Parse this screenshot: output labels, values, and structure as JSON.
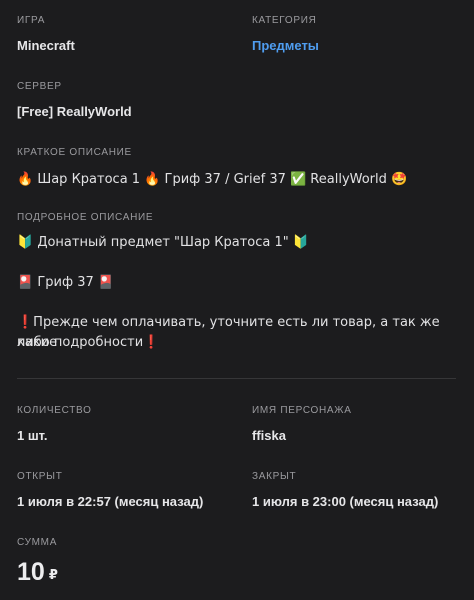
{
  "game": {
    "label": "Игра",
    "value": "Minecraft"
  },
  "category": {
    "label": "Категория",
    "value": "Предметы"
  },
  "server": {
    "label": "Сервер",
    "value": "[Free] ReallyWorld"
  },
  "short_description": {
    "label": "Краткое описание",
    "value": "🔥 Шар Кратоса 1 🔥 Гриф 37 / Grief 37 ✅ ReallyWorld 🤩"
  },
  "full_description": {
    "label": "Подробное описание",
    "line1": "🔰 Донатный предмет \"Шар Кратоса 1\" 🔰",
    "line2": "🎴 Гриф 37 🎴",
    "line3": "❗Прежде чем оплачивать, уточните есть ли товар, а так же какие",
    "line4": "либо подробности❗"
  },
  "quantity": {
    "label": "Количество",
    "value": "1 шт."
  },
  "character": {
    "label": "Имя персонажа",
    "value": "ffiska"
  },
  "opened": {
    "label": "Открыт",
    "value": "1 июля в 22:57 (месяц назад)"
  },
  "closed": {
    "label": "Закрыт",
    "value": "1 июля в 23:00 (месяц назад)"
  },
  "sum": {
    "label": "Сумма",
    "amount": "10",
    "currency": "₽"
  }
}
